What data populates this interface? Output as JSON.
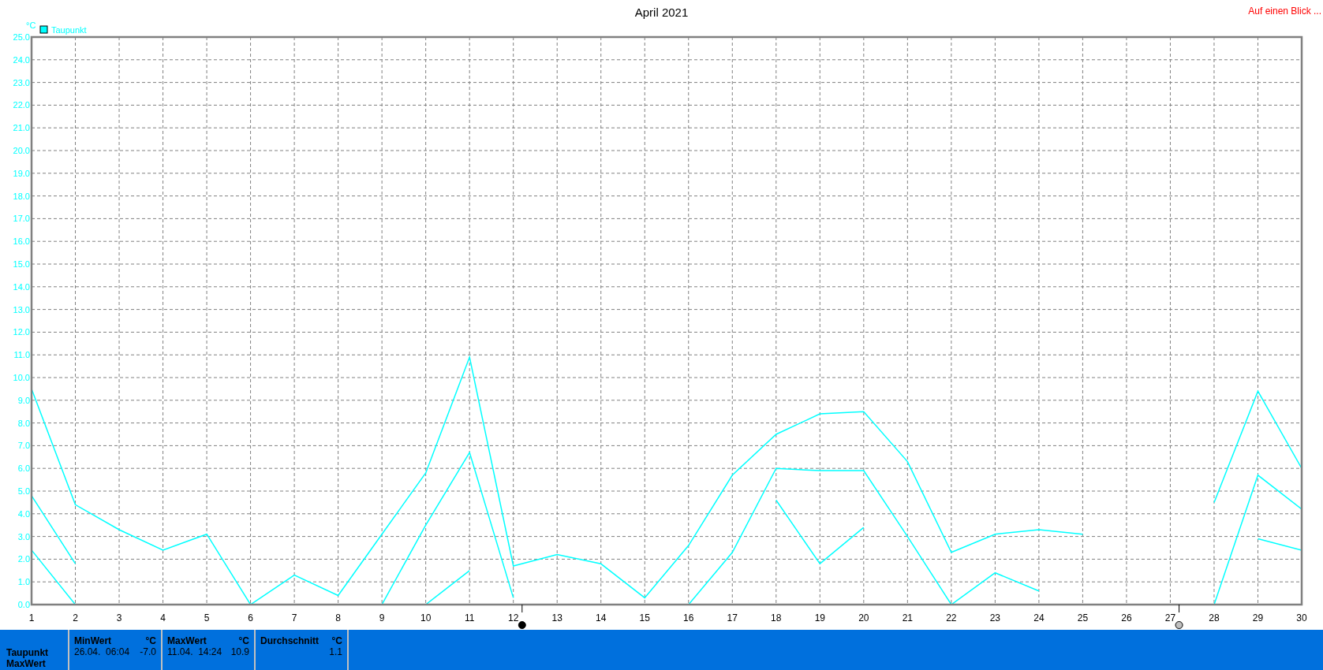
{
  "title": "April 2021",
  "link": "Auf einen Blick ...",
  "chart": {
    "unit": "°C",
    "legend": [
      {
        "label": "Taupunkt",
        "color": "#00ffff"
      }
    ],
    "chart_data": {
      "type": "line",
      "xlim": [
        1,
        30
      ],
      "ylim": [
        0,
        25
      ],
      "x": [
        1,
        2,
        3,
        4,
        5,
        6,
        7,
        8,
        9,
        10,
        11,
        12,
        13,
        14,
        15,
        16,
        17,
        18,
        19,
        20,
        21,
        22,
        23,
        24,
        25,
        26,
        27,
        28,
        29,
        30
      ],
      "xticks": [
        1,
        2,
        3,
        4,
        5,
        6,
        7,
        8,
        9,
        10,
        11,
        12,
        13,
        14,
        15,
        16,
        17,
        18,
        19,
        20,
        21,
        22,
        23,
        24,
        25,
        26,
        27,
        28,
        29,
        30
      ],
      "yticks": [
        {
          "value": 0,
          "label": "0.0"
        },
        {
          "value": 1,
          "label": "1.0"
        },
        {
          "value": 2,
          "label": "2.0"
        },
        {
          "value": 3,
          "label": "3.0"
        },
        {
          "value": 4,
          "label": "4.0"
        },
        {
          "value": 5,
          "label": "5.0"
        },
        {
          "value": 6,
          "label": "6.0"
        },
        {
          "value": 7,
          "label": "7.0"
        },
        {
          "value": 8,
          "label": "8.0"
        },
        {
          "value": 9,
          "label": "9.0"
        },
        {
          "value": 10,
          "label": "10.0"
        },
        {
          "value": 11,
          "label": "11.0"
        },
        {
          "value": 12,
          "label": "12.0"
        },
        {
          "value": 13,
          "label": "13.0"
        },
        {
          "value": 14,
          "label": "14.0"
        },
        {
          "value": 15,
          "label": "15.0"
        },
        {
          "value": 16,
          "label": "16.0"
        },
        {
          "value": 17,
          "label": "17.0"
        },
        {
          "value": 18,
          "label": "18.0"
        },
        {
          "value": 19,
          "label": "19.0"
        },
        {
          "value": 20,
          "label": "20.0"
        },
        {
          "value": 21,
          "label": "21.0"
        },
        {
          "value": 22,
          "label": "22.0"
        },
        {
          "value": 23,
          "label": "23.0"
        },
        {
          "value": 24,
          "label": "24.0"
        },
        {
          "value": 25,
          "label": "25.0"
        }
      ],
      "series": [
        {
          "color": "#00ffff",
          "values": [
            9.5,
            4.4,
            3.3,
            2.4,
            3.1,
            0.0,
            1.3,
            0.4,
            3.1,
            5.8,
            10.9,
            1.7,
            2.2,
            1.8,
            0.3,
            2.6,
            5.7,
            7.5,
            8.4,
            8.5,
            6.3,
            2.3,
            3.1,
            3.3,
            3.1,
            null,
            null,
            4.5,
            9.4,
            6.0
          ]
        },
        {
          "color": "#00ffff",
          "values": [
            4.8,
            1.8,
            null,
            null,
            null,
            null,
            null,
            null,
            0.0,
            3.5,
            6.7,
            0.3,
            null,
            null,
            null,
            0.0,
            2.3,
            6.0,
            5.9,
            5.9,
            3.0,
            0.0,
            1.4,
            0.6,
            null,
            null,
            null,
            0.0,
            5.7,
            4.2
          ]
        },
        {
          "color": "#00ffff",
          "values": [
            2.4,
            0.0,
            null,
            null,
            null,
            null,
            null,
            null,
            null,
            0.0,
            1.5,
            null,
            null,
            null,
            null,
            null,
            null,
            4.6,
            1.8,
            3.4,
            null,
            null,
            null,
            null,
            null,
            null,
            null,
            null,
            2.9,
            2.4
          ]
        }
      ],
      "grid": true
    },
    "moon_phases": [
      {
        "kind": "new_moon"
      },
      {
        "kind": "full_moon"
      }
    ]
  },
  "stats": {
    "row_labels": [
      "Taupunkt",
      "MaxWert"
    ],
    "columns": [
      {
        "heading": "MinWert",
        "unit": "°C",
        "date": "26.04.  06:04",
        "value": "-7.0"
      },
      {
        "heading": "MaxWert",
        "unit": "°C",
        "date": "11.04.  14:24",
        "value": "10.9"
      },
      {
        "heading": "Durchschnitt",
        "unit": "°C",
        "value": "1.1"
      }
    ]
  }
}
